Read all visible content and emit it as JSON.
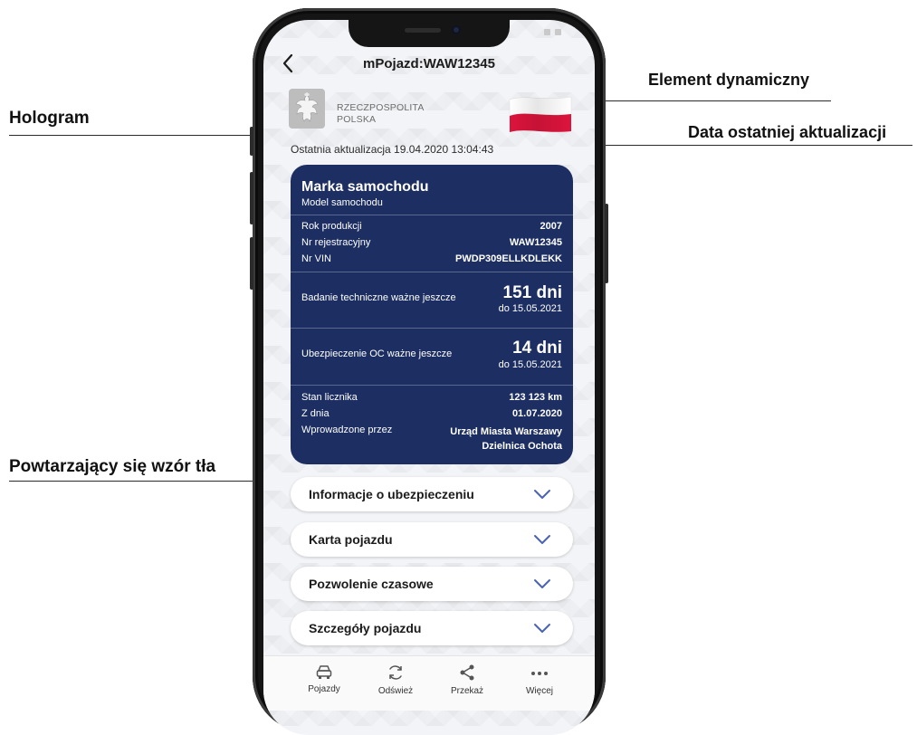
{
  "callouts": {
    "element_dynamiczny": "Element dynamiczny",
    "hologram": "Hologram",
    "data_aktualizacji": "Data ostatniej aktualizacji",
    "wzor_tla": "Powtarzający się wzór tła"
  },
  "header": {
    "title": "mPojazd:WAW12345",
    "back_icon": "chevron-left-icon"
  },
  "emblem": {
    "line1": "RZECZPOSPOLITA",
    "line2": "POLSKA"
  },
  "flag_colors": {
    "top": "#ffffff",
    "bottom": "#dc143c"
  },
  "last_update": "Ostatnia aktualizacja 19.04.2020 13:04:43",
  "card": {
    "color": "#1d2f62",
    "brand": "Marka samochodu",
    "model": "Model samochodu",
    "rows": [
      {
        "label": "Rok produkcji",
        "value": "2007"
      },
      {
        "label": "Nr rejestracyjny",
        "value": "WAW12345"
      },
      {
        "label": "Nr VIN",
        "value": "PWDP309ELLKDLEKK"
      }
    ],
    "badanie": {
      "label": "Badanie techniczne ważne jeszcze",
      "value": "151 dni",
      "sub": "do 15.05.2021"
    },
    "oc": {
      "label": "Ubezpieczenie OC ważne jeszcze",
      "value": "14 dni",
      "sub": "do 15.05.2021"
    },
    "licznik": [
      {
        "label": "Stan licznika",
        "value": "123 123 km"
      },
      {
        "label": "Z dnia",
        "value": "01.07.2020"
      }
    ],
    "wprowadzone": {
      "label": "Wprowadzone przez",
      "value1": "Urząd Miasta Warszawy",
      "value2": "Dzielnica Ochota"
    }
  },
  "accordion": [
    {
      "label": "Informacje o ubezpieczeniu"
    },
    {
      "label": "Karta pojazdu"
    },
    {
      "label": "Pozwolenie czasowe"
    },
    {
      "label": "Szczegóły pojazdu"
    }
  ],
  "accent": "#4a63b5",
  "nav": [
    {
      "label": "Pojazdy",
      "icon": "car-icon"
    },
    {
      "label": "Odśwież",
      "icon": "refresh-icon"
    },
    {
      "label": "Przekaż",
      "icon": "share-icon"
    },
    {
      "label": "Więcej",
      "icon": "more-icon"
    }
  ]
}
